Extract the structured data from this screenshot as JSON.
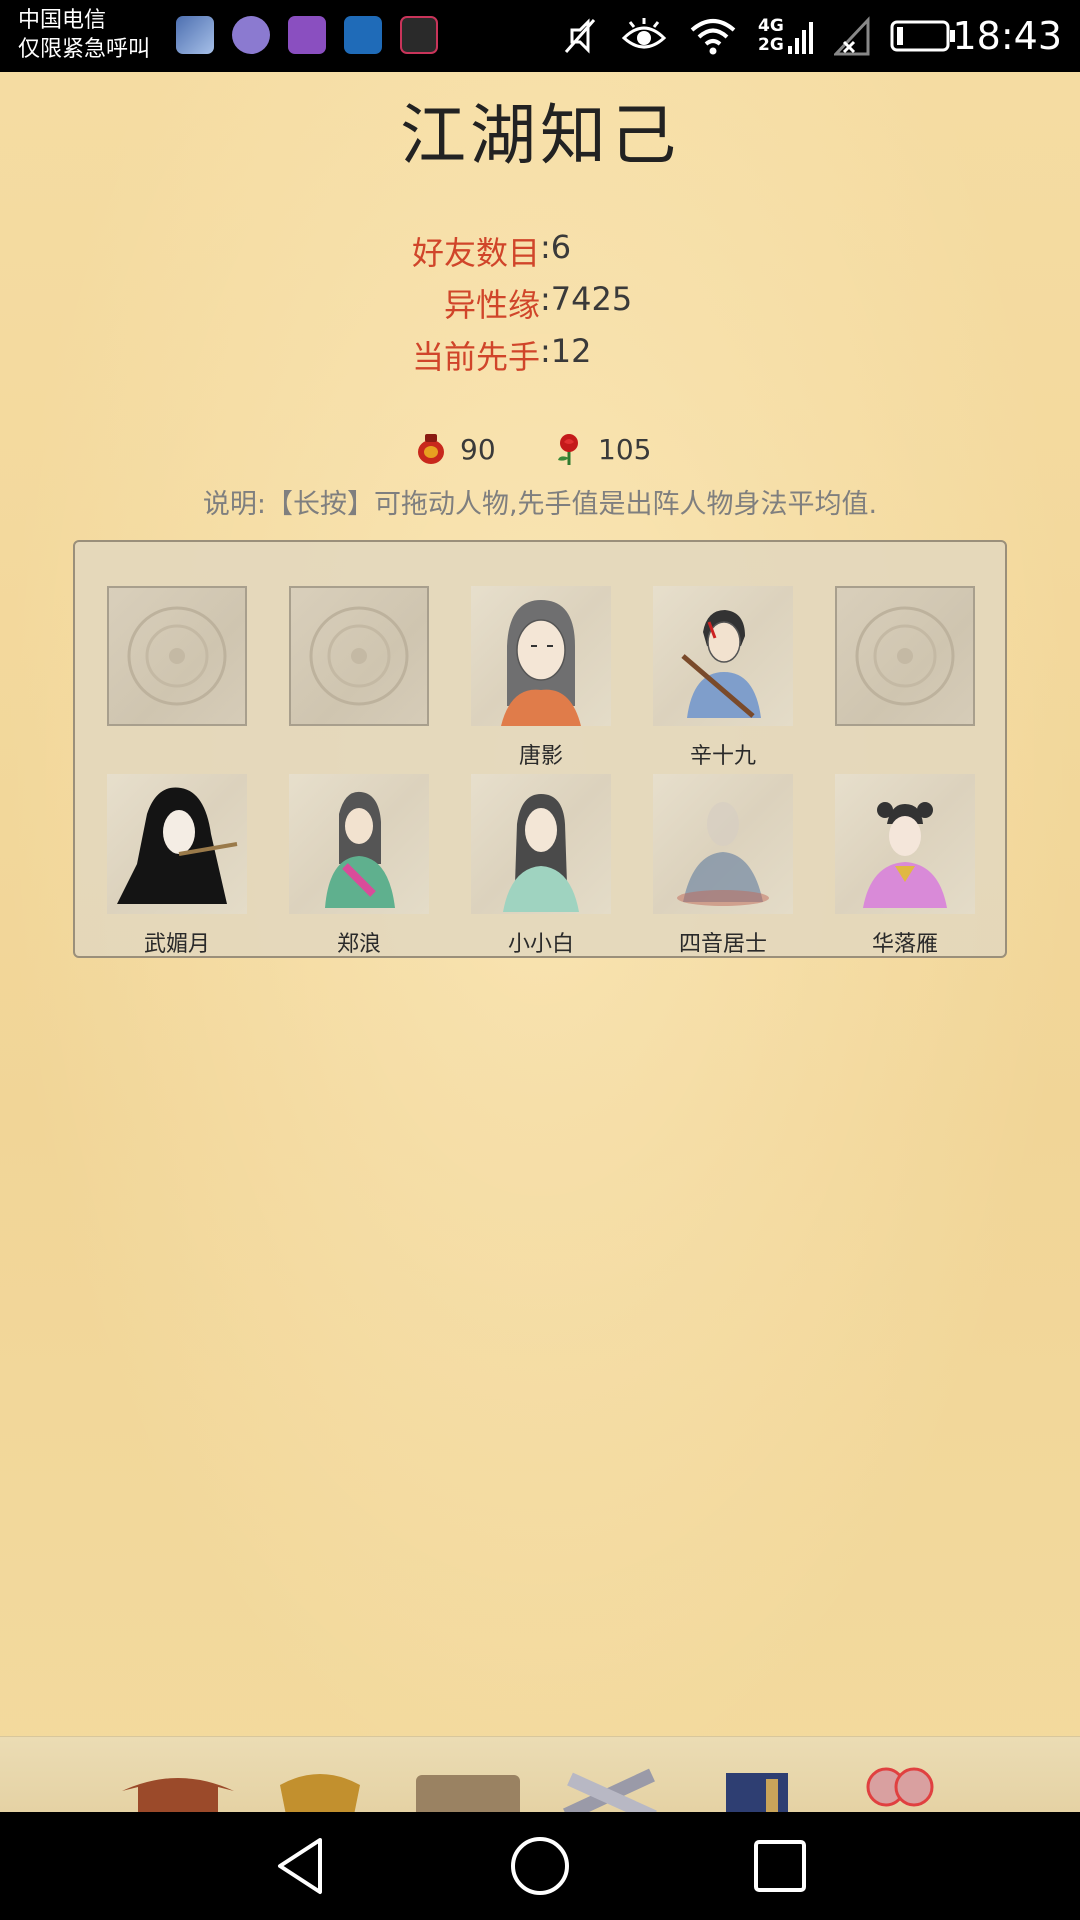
{
  "status_bar": {
    "carrier_line1": "中国电信",
    "carrier_line2": "仅限紧急呼叫",
    "network_4g": "4G",
    "network_2g": "2G",
    "time": "18:43"
  },
  "page": {
    "title": "江湖知己",
    "stats": [
      {
        "label": "好友数目",
        "value": ":6"
      },
      {
        "label": "异性缘",
        "value": ":7425"
      },
      {
        "label": "当前先手",
        "value": ":12"
      }
    ],
    "resources": {
      "wine": "90",
      "rose": "105"
    },
    "hint": "说明:【长按】可拖动人物,先手值是出阵人物身法平均值."
  },
  "friends": {
    "row1": [
      {
        "name": "",
        "empty": true
      },
      {
        "name": "",
        "empty": true
      },
      {
        "name": "唐影",
        "empty": false
      },
      {
        "name": "辛十九",
        "empty": false
      },
      {
        "name": "",
        "empty": true
      }
    ],
    "row2": [
      {
        "name": "武媚月"
      },
      {
        "name": "郑浪"
      },
      {
        "name": "小小白"
      },
      {
        "name": "四音居士"
      },
      {
        "name": "华落雁"
      }
    ]
  },
  "colors": {
    "label_red": "#d0452a",
    "parchment": "#f3d89a"
  }
}
